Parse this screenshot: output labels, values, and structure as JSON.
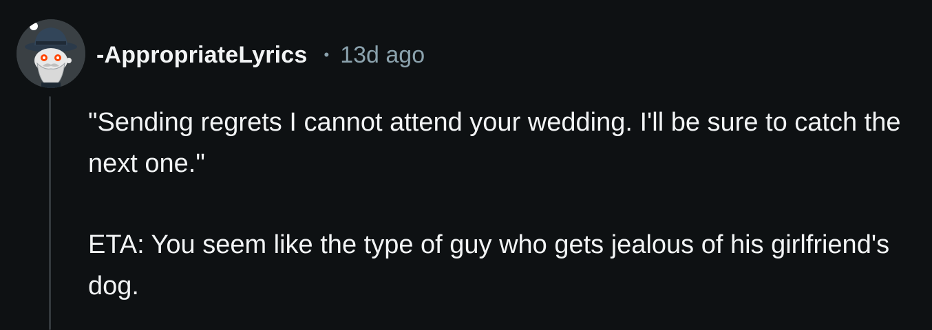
{
  "comment": {
    "avatar_icon": "snoo-avatar-icon",
    "author": "-AppropriateLyrics",
    "separator": "•",
    "time_ago": "13d ago",
    "paragraphs": [
      "\"Sending regrets I cannot attend your wedding. I'll be sure to catch the next one.\"",
      "ETA: You seem like the type of guy who gets jealous of his girlfriend's dog."
    ]
  },
  "colors": {
    "background": "#0e1113",
    "text": "#f2f4f5",
    "muted": "#8ba2ad",
    "thread_line": "#33393d"
  }
}
